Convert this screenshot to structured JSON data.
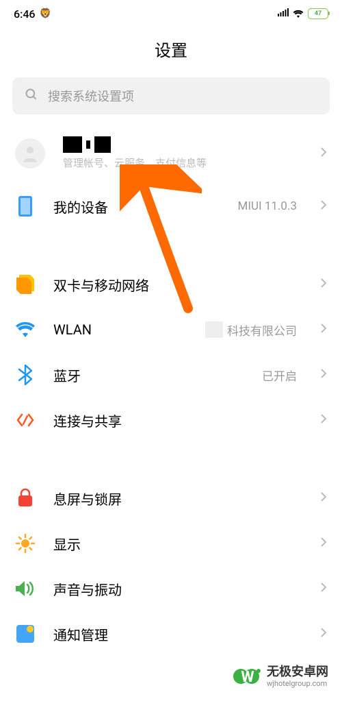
{
  "status": {
    "time": "6:46",
    "battery": "47"
  },
  "page": {
    "title": "设置"
  },
  "search": {
    "placeholder": "搜索系统设置项"
  },
  "account": {
    "subtitle": "管理帐号、云服务、支付信息等"
  },
  "items": {
    "device": {
      "title": "我的设备",
      "value": "MIUI 11.0.3"
    },
    "sim": {
      "title": "双卡与移动网络"
    },
    "wlan": {
      "title": "WLAN",
      "value": "科技有限公司"
    },
    "bluetooth": {
      "title": "蓝牙",
      "value": "已开启"
    },
    "connection": {
      "title": "连接与共享"
    },
    "lockscreen": {
      "title": "息屏与锁屏"
    },
    "display": {
      "title": "显示"
    },
    "sound": {
      "title": "声音与振动"
    },
    "notifications": {
      "title": "通知管理"
    }
  },
  "watermark": {
    "title": "无极安卓网",
    "url": "wjhotelgroup.com"
  }
}
